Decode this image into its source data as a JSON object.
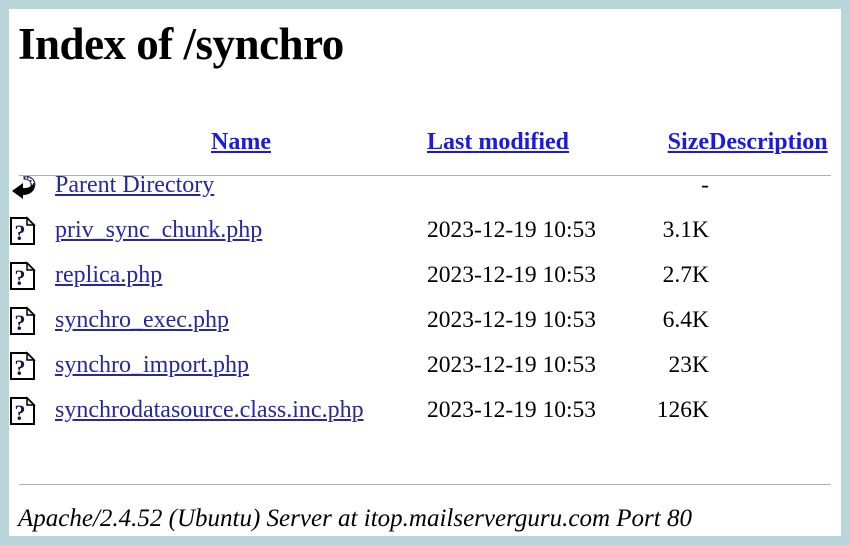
{
  "page": {
    "title": "Index of /synchro",
    "background_color": "#b9d5da",
    "content_color": "#ffffff",
    "header_link_color": "#1a1ae0",
    "file_link_color": "#27279e"
  },
  "table": {
    "headers": {
      "name": "Name",
      "last_modified": "Last modified",
      "size": "Size",
      "description": "Description"
    },
    "parent": {
      "icon": "back-arrow-icon",
      "label": "Parent Directory",
      "last_modified": "",
      "size": "-",
      "description": ""
    },
    "rows": [
      {
        "icon": "unknown-file-icon",
        "name": "priv_sync_chunk.php",
        "last_modified": "2023-12-19 10:53",
        "size": "3.1K",
        "description": ""
      },
      {
        "icon": "unknown-file-icon",
        "name": "replica.php",
        "last_modified": "2023-12-19 10:53",
        "size": "2.7K",
        "description": ""
      },
      {
        "icon": "unknown-file-icon",
        "name": "synchro_exec.php",
        "last_modified": "2023-12-19 10:53",
        "size": "6.4K",
        "description": ""
      },
      {
        "icon": "unknown-file-icon",
        "name": "synchro_import.php",
        "last_modified": "2023-12-19 10:53",
        "size": "23K",
        "description": ""
      },
      {
        "icon": "unknown-file-icon",
        "name": "synchrodatasource.class.inc.php",
        "last_modified": "2023-12-19 10:53",
        "size": "126K",
        "description": ""
      }
    ]
  },
  "footer": {
    "text": "Apache/2.4.52 (Ubuntu) Server at itop.mailserverguru.com Port 80"
  }
}
